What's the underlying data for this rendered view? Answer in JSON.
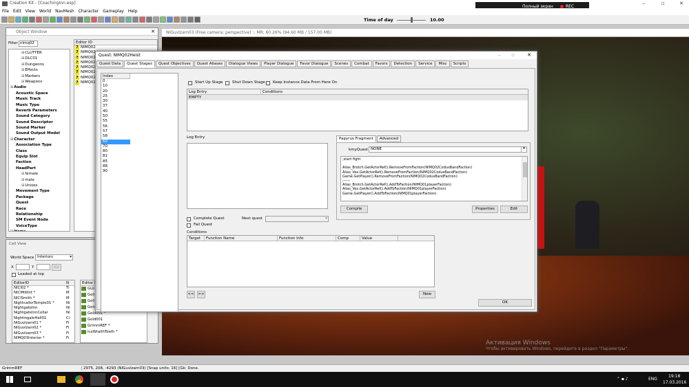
{
  "app": {
    "title": "Creation Kit - [CoachingInn.esp]",
    "menu": [
      "File",
      "Edit",
      "View",
      "World",
      "NavMesh",
      "Character",
      "Gameplay",
      "Help"
    ],
    "time_label": "Time of day",
    "time_value": "10.00"
  },
  "recorder": {
    "fullscreen": "Полный экран",
    "rec": "REC"
  },
  "object_window": {
    "title": "Object Window",
    "filter_label": "Filter",
    "filter_value": "nimq02",
    "header": "Editor ID",
    "tree": [
      {
        "text": "CLUTTER",
        "level": 2,
        "bold": false
      },
      {
        "text": "DLC01",
        "level": 2,
        "bold": false
      },
      {
        "text": "Dungeons",
        "level": 2,
        "bold": false
      },
      {
        "text": "Effects",
        "level": 2,
        "bold": false
      },
      {
        "text": "Markers",
        "level": 2,
        "bold": false
      },
      {
        "text": "Weapons",
        "level": 2,
        "bold": false
      },
      {
        "text": "Audio",
        "level": 0,
        "bold": true
      },
      {
        "text": "Acoustic Space",
        "level": 1,
        "bold": true
      },
      {
        "text": "Music Track",
        "level": 1,
        "bold": true
      },
      {
        "text": "Music Type",
        "level": 1,
        "bold": true
      },
      {
        "text": "Reverb Parameters",
        "level": 1,
        "bold": true
      },
      {
        "text": "Sound Category",
        "level": 1,
        "bold": true
      },
      {
        "text": "Sound Descriptor",
        "level": 1,
        "bold": true
      },
      {
        "text": "Sound Marker",
        "level": 1,
        "bold": true
      },
      {
        "text": "Sound Output Model",
        "level": 1,
        "bold": true
      },
      {
        "text": "Character",
        "level": 0,
        "bold": true
      },
      {
        "text": "Association Type",
        "level": 1,
        "bold": true
      },
      {
        "text": "Class",
        "level": 1,
        "bold": true
      },
      {
        "text": "Equip Slot",
        "level": 1,
        "bold": true
      },
      {
        "text": "Faction",
        "level": 1,
        "bold": true
      },
      {
        "text": "HeadPart",
        "level": 1,
        "bold": true
      },
      {
        "text": "female",
        "level": 2,
        "bold": false
      },
      {
        "text": "male",
        "level": 2,
        "bold": false
      },
      {
        "text": "Unisex",
        "level": 2,
        "bold": false
      },
      {
        "text": "Movement Type",
        "level": 1,
        "bold": true
      },
      {
        "text": "Package",
        "level": 1,
        "bold": true
      },
      {
        "text": "Quest",
        "level": 1,
        "bold": true
      },
      {
        "text": "Race",
        "level": 1,
        "bold": true
      },
      {
        "text": "Relationship",
        "level": 1,
        "bold": true
      },
      {
        "text": "SM Event Node",
        "level": 1,
        "bold": true
      },
      {
        "text": "VoiceType",
        "level": 1,
        "bold": true
      },
      {
        "text": "Items",
        "level": 0,
        "bold": true
      }
    ],
    "list": [
      "NIMQ02",
      "NIMQ02",
      "NIMQ02",
      "NIMQ02",
      "NIMQ02",
      "NIMQ02",
      "NIMQ02",
      "NIMQ02"
    ]
  },
  "cell_view": {
    "title": "Cell View",
    "worldspace_label": "World Space",
    "worldspace_value": "Interiors",
    "x": "X",
    "y": "Y",
    "go": "Go",
    "loaded_at_top": "Loaded at top",
    "col1": "EditorID",
    "col2": "N",
    "cells": [
      [
        "NICI02 *",
        "Ti"
      ],
      [
        "NICIMillInt *",
        "M"
      ],
      [
        "NICISmith *",
        "M"
      ],
      [
        "NightcallerTemple01 *",
        "Ni"
      ],
      [
        "NightgateInn",
        "Ni"
      ],
      [
        "NightgateInnCellar",
        "Ni"
      ],
      [
        "NightingaleHall01",
        "Ci"
      ],
      [
        "NIGuvlzarn01 *",
        "Fi"
      ],
      [
        "NIGuvlzarn02 *",
        "Fi"
      ],
      [
        "NIGuvlzarn03 *",
        "Fi"
      ],
      [
        "NIMQ03Interior *",
        "Fi"
      ]
    ],
    "objects_header": "Editor ID",
    "objects": [
      "GLb",
      "Goli",
      "Goli",
      "Gold001",
      "Gold001 *",
      "Gold001",
      "GrimmREF *",
      "IceWraithTeeth *"
    ]
  },
  "render": {
    "title": "NIGuvlzarn03 (Free camera; perspective) :: MR: 60.26% (94.60 MB / 157.00 MB)",
    "watermark1": "Активация Windows",
    "watermark2": "Чтобы активировать Windows, перейдите в раздел \"Параметры\"."
  },
  "quest": {
    "title": "Quest: NIMQ02Heist",
    "tabs": [
      "Quest Data",
      "Quest Stages",
      "Quest Objectives",
      "Quest Aliases",
      "Dialogue Views",
      "Player Dialogue",
      "Favor Dialogue",
      "Scenes",
      "Combat",
      "Favors",
      "Detection",
      "Service",
      "Misc",
      "Scripts"
    ],
    "index_header": "Index",
    "indices": [
      "0",
      "10",
      "20",
      "25",
      "30",
      "37",
      "40",
      "50",
      "55",
      "56",
      "57",
      "58",
      "60",
      "70",
      "80",
      "81",
      "85",
      "88",
      "90"
    ],
    "selected_index": "60",
    "startup": "Start Up Stage",
    "shutdown": "Shut Down Stage",
    "keep": "Keep Instance Data From Here On",
    "log_entry_col": "Log Entry",
    "conditions_col": "Conditions",
    "log_entry_value": "EMPTY",
    "log_entry_label": "Log Entry",
    "frag_tab": "Papyrus Fragment",
    "adv_tab": "Advanced",
    "kmy_label": "kmyQuest",
    "kmy_value": "NONE",
    "code": [
      ";start fight",
      "",
      "Alias_Brotch.GetActorRef().RemoveFromFaction(NIMQ02CodusBandFaction)",
      "Alias_Vex.GetActorRef().RemoveFromFaction(NIMQ02CodusBandFaction)",
      "Game.GetPlayer().RemoveFromFaction(NIMQ02CodusBandFaction)",
      ";-----",
      "Alias_Brotch.GetActorRef().AddToFaction(NIMQ01playerFaction)",
      "Alias_Vex.GetActorRef().AddToFaction(NIMQ01playerFaction)",
      "Game.GetPlayer().AddToFaction(NIMQ01playerFaction)"
    ],
    "compile": "Compile",
    "properties": "Properties",
    "edit": "Edit",
    "complete": "Complete Quest",
    "fail": "Fail Quest",
    "next": "Next quest",
    "conditions_label": "Conditions",
    "cond_cols": [
      "Target",
      "Function Name",
      "Function Info",
      "Comp",
      "Value"
    ],
    "prev": "<<",
    "nextbtn": ">>",
    "new": "New",
    "ok": "OK"
  },
  "status": {
    "left": "GrimmREF",
    "mid": "2975, 208, -4293 (NIGuvlzarn03) [Snap units: 16] [Gk: Done."
  },
  "taskbar": {
    "lang": "ENG",
    "time": "19:18",
    "date": "17.03.2016"
  }
}
